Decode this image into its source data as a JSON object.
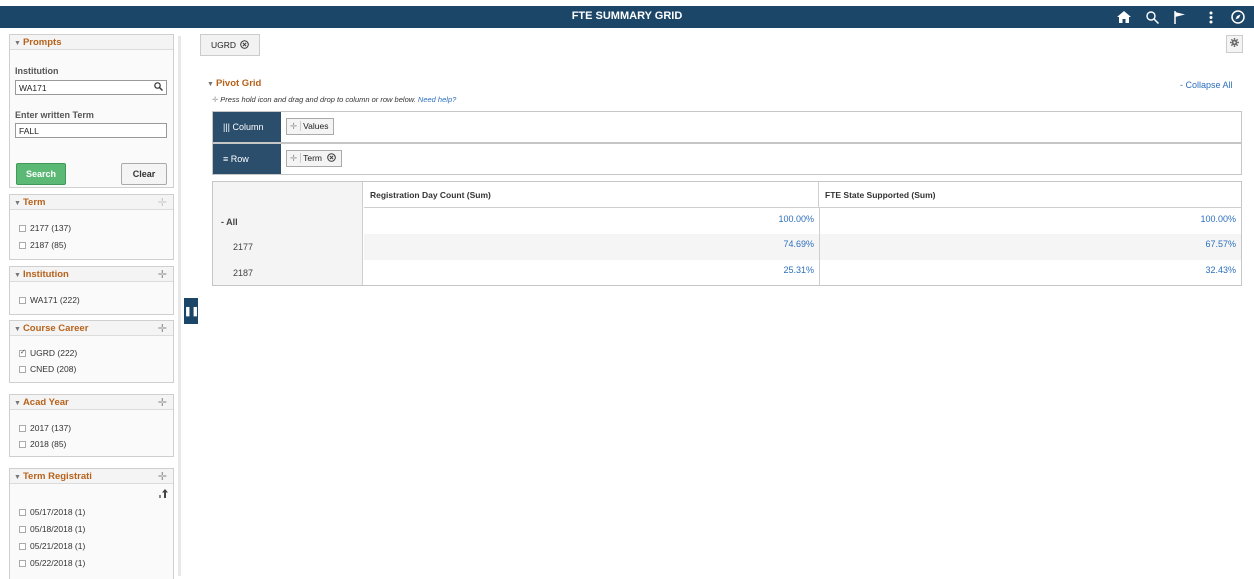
{
  "header": {
    "title": "FTE SUMMARY GRID",
    "icons": [
      "home-icon",
      "search-icon",
      "flag-icon",
      "more-icon",
      "navbar-icon"
    ]
  },
  "sidebar": {
    "prompts": {
      "title": "Prompts",
      "institution_label": "Institution",
      "institution_value": "WA171",
      "term_label": "Enter written Term",
      "term_value": "FALL",
      "search_label": "Search",
      "clear_label": "Clear"
    },
    "facets": [
      {
        "title": "Term",
        "items": [
          {
            "label": "2177 (137)",
            "checked": false
          },
          {
            "label": "2187 (85)",
            "checked": false
          }
        ]
      },
      {
        "title": "Institution",
        "items": [
          {
            "label": "WA171 (222)",
            "checked": false
          }
        ]
      },
      {
        "title": "Course Career",
        "items": [
          {
            "label": "UGRD (222)",
            "checked": true
          },
          {
            "label": "CNED (208)",
            "checked": false
          }
        ]
      },
      {
        "title": "Acad Year",
        "items": [
          {
            "label": "2017 (137)",
            "checked": false
          },
          {
            "label": "2018 (85)",
            "checked": false
          }
        ]
      },
      {
        "title": "Term Registrati",
        "items": [
          {
            "label": "05/17/2018 (1)",
            "checked": false
          },
          {
            "label": "05/18/2018 (1)",
            "checked": false
          },
          {
            "label": "05/21/2018 (1)",
            "checked": false
          },
          {
            "label": "05/22/2018 (1)",
            "checked": false
          }
        ]
      }
    ]
  },
  "main": {
    "filter_tag": "UGRD",
    "pivot": {
      "title": "Pivot Grid",
      "hint": "Press hold icon and drag and drop to column or row below.",
      "help_link": "Need help?",
      "collapse_all": "- Collapse All",
      "column_label": "Column",
      "column_chip": "Values",
      "row_label": "Row",
      "row_chip": "Term"
    },
    "grid": {
      "columns": [
        "Registration Day Count (Sum)",
        "FTE State Supported (Sum)"
      ],
      "rows": [
        {
          "label": "- All",
          "values": [
            "100.00%",
            "100.00%"
          ]
        },
        {
          "label": "2177",
          "values": [
            "74.69%",
            "67.57%"
          ]
        },
        {
          "label": "2187",
          "values": [
            "25.31%",
            "32.43%"
          ]
        }
      ]
    }
  },
  "colors": {
    "header_bg": "#1c4668",
    "accent_orange": "#b7621b",
    "link_blue": "#2c6fbd",
    "search_green": "#5cb875"
  }
}
